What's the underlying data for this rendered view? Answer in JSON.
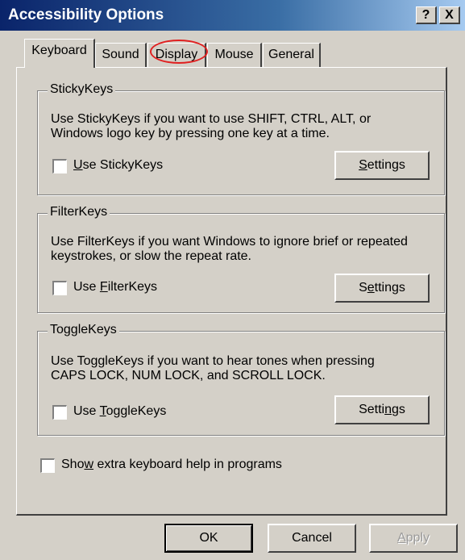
{
  "window": {
    "title": "Accessibility Options",
    "help_label": "?",
    "close_label": "X"
  },
  "tabs": [
    {
      "label": "Keyboard"
    },
    {
      "label": "Sound"
    },
    {
      "label": "Display"
    },
    {
      "label": "Mouse"
    },
    {
      "label": "General"
    }
  ],
  "groups": {
    "stickykeys": {
      "title": "StickyKeys",
      "desc_line1": "Use StickyKeys if you want to use SHIFT, CTRL, ALT, or",
      "desc_line2": "Windows logo key by pressing one key at a time.",
      "check_u": "U",
      "check_rest": "se StickyKeys",
      "settings_u": "S",
      "settings_rest": "ettings"
    },
    "filterkeys": {
      "title": "FilterKeys",
      "desc_line1": "Use FilterKeys if you want Windows to ignore brief or repeated",
      "desc_line2": "keystrokes, or slow the repeat rate.",
      "check_pre": "Use ",
      "check_u": "F",
      "check_rest": "ilterKeys",
      "settings_pre": "S",
      "settings_u": "e",
      "settings_rest": "ttings"
    },
    "togglekeys": {
      "title": "ToggleKeys",
      "desc_line1": "Use ToggleKeys if you want to hear tones when pressing",
      "desc_line2": "CAPS LOCK, NUM LOCK, and SCROLL LOCK.",
      "check_pre": "Use ",
      "check_u": "T",
      "check_rest": "oggleKeys",
      "settings_pre": "Setti",
      "settings_u": "n",
      "settings_rest": "gs"
    }
  },
  "extra_help": {
    "pre": "Sho",
    "u": "w",
    "rest": " extra keyboard help in programs"
  },
  "buttons": {
    "ok": "OK",
    "cancel": "Cancel",
    "apply_u": "A",
    "apply_rest": "pply"
  }
}
